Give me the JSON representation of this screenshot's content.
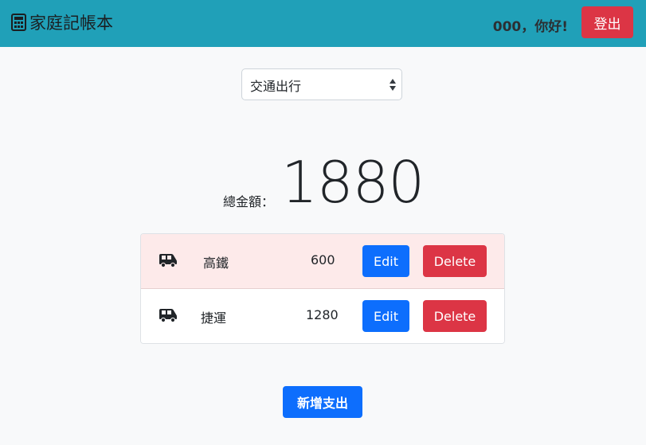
{
  "navbar": {
    "icon": "calculator-icon",
    "title": "家庭記帳本",
    "greeting": "000，你好!",
    "logout_label": "登出",
    "background": "#20a0b8"
  },
  "filter": {
    "selected": "交通出行"
  },
  "summary": {
    "label": "總金額：",
    "total": "1880"
  },
  "expenses": [
    {
      "icon": "van-icon",
      "name": "高鐵",
      "amount": "600",
      "edit_label": "Edit",
      "delete_label": "Delete",
      "highlighted": true
    },
    {
      "icon": "van-icon",
      "name": "捷運",
      "amount": "1280",
      "edit_label": "Edit",
      "delete_label": "Delete",
      "highlighted": false
    }
  ],
  "actions": {
    "add_label": "新增支出"
  },
  "colors": {
    "primary": "#0d6efd",
    "danger": "#dc3545",
    "highlight_row": "#fdeaea"
  }
}
